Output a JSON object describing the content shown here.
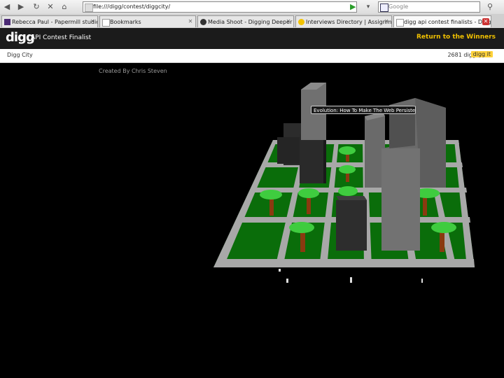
{
  "browser": {
    "url": "file:///digg/contest/diggcity/",
    "search_placeholder": "Google",
    "tabs": [
      {
        "label": "Rebecca Paul - Papermill studio",
        "active": false
      },
      {
        "label": "Bookmarks",
        "active": false
      },
      {
        "label": "Media Shoot - Digging Deeper - Food Digg",
        "active": false
      },
      {
        "label": "Interviews Directory | Assignment Desk",
        "active": false
      },
      {
        "label": "digg api contest finalists - Digg City",
        "active": true
      }
    ],
    "window_controls": {
      "minimize": "–",
      "restore": "ð",
      "close": "✕"
    }
  },
  "header": {
    "logo": "digg",
    "subtitle": "API Contest Finalist",
    "return_link": "Return to the Winners"
  },
  "subbar": {
    "app_name": "Digg City",
    "digg_count": "2681 diggs",
    "digg_button": "digg it"
  },
  "scene": {
    "created_by": "Created By Chris Steven",
    "tooltip": "Evolution: How To Make The Web Persistent"
  },
  "colors": {
    "grass": "#0a6d0a",
    "road": "#a8a8a8",
    "building_gray": "#6e6e6e",
    "building_dark": "#2c2c2c",
    "tree_leaf": "#3fcc3f",
    "tree_trunk": "#8a3a10"
  }
}
